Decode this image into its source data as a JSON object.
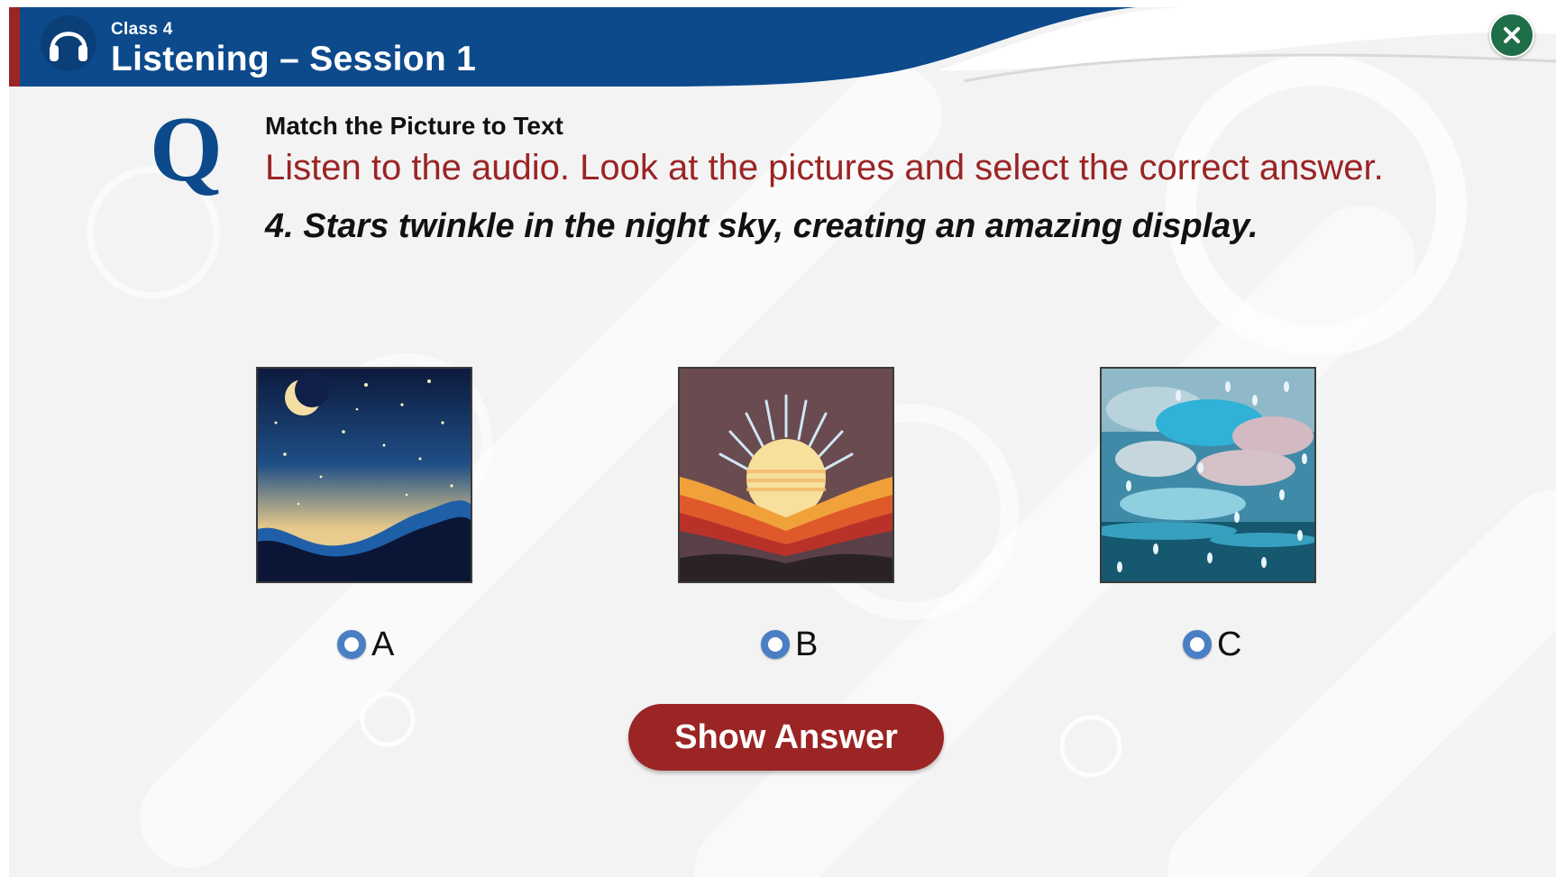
{
  "header": {
    "class_label": "Class 4",
    "title": "Listening – Session 1",
    "icon": "headphones-icon",
    "close_icon": "close-icon"
  },
  "question": {
    "icon_letter": "Q",
    "type_label": "Match the Picture to Text",
    "instruction": "Listen to the audio. Look at the pictures and select the correct answer.",
    "text": "4. Stars twinkle in the night sky, creating an amazing display."
  },
  "options": [
    {
      "label": "A",
      "image": "starry-night-image"
    },
    {
      "label": "B",
      "image": "sunrise-image"
    },
    {
      "label": "C",
      "image": "rain-clouds-image"
    }
  ],
  "actions": {
    "show_answer_label": "Show Answer"
  },
  "colors": {
    "brand_blue": "#0c4a8c",
    "accent_red": "#9b2424",
    "radio_blue": "#4b7fc4",
    "close_green": "#1f6e4a"
  }
}
